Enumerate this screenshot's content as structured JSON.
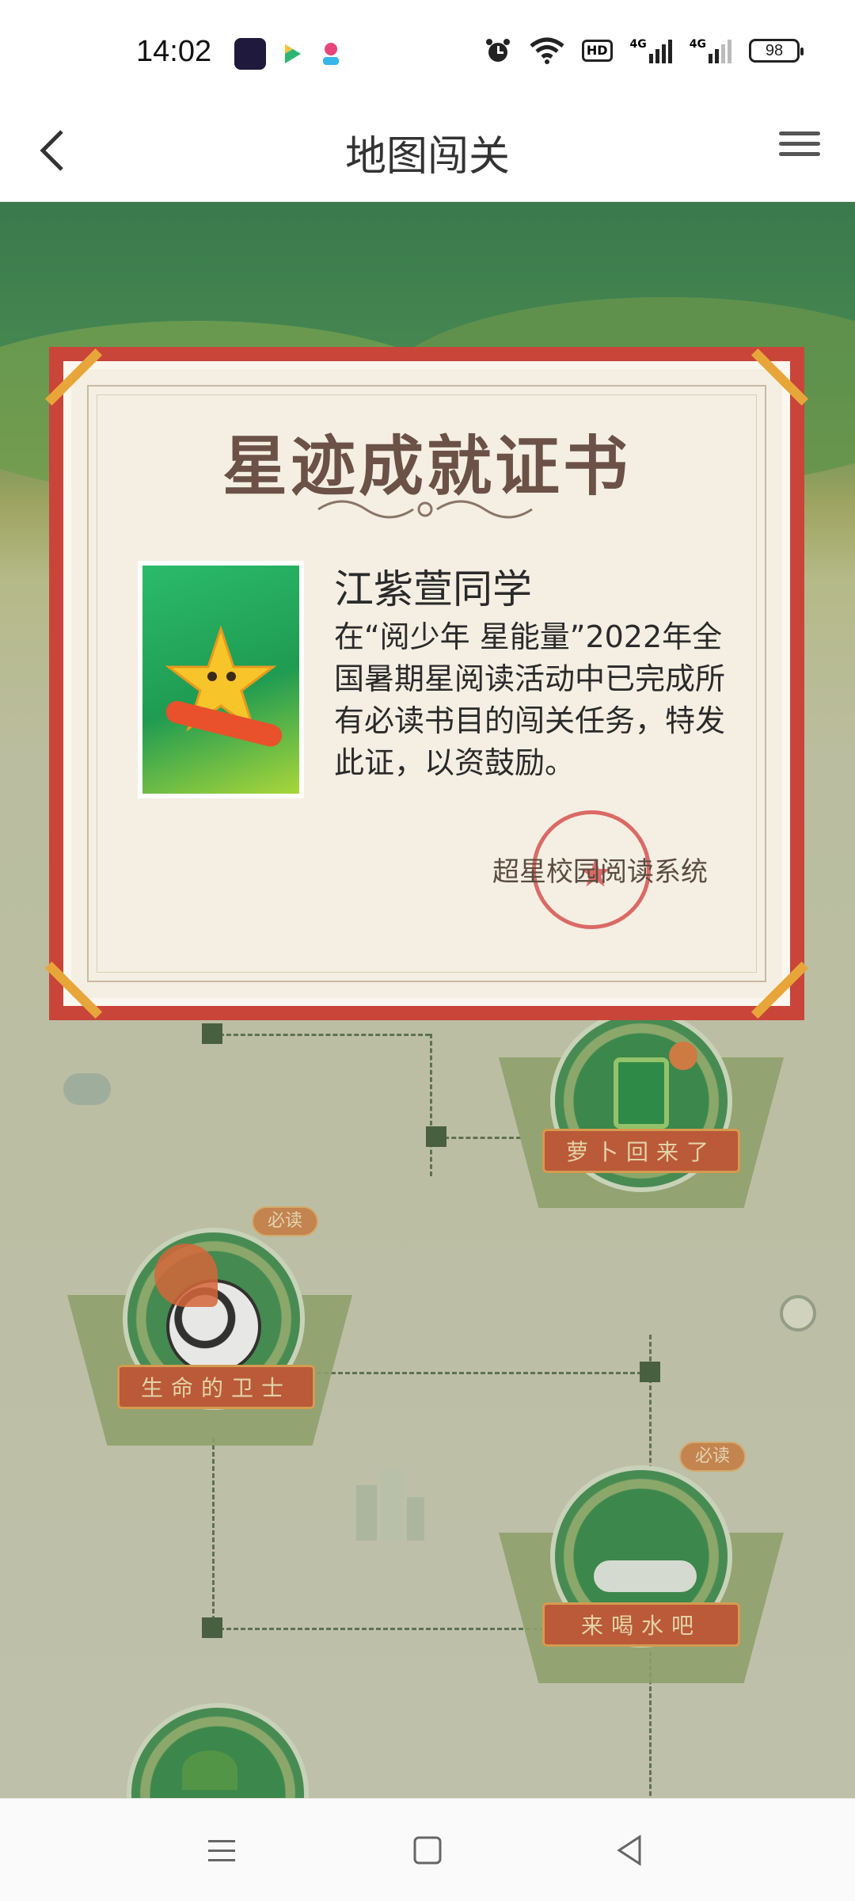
{
  "status_bar": {
    "time": "14:02",
    "battery": "98",
    "network": "4G",
    "hd_label": "HD"
  },
  "nav": {
    "title": "地图闯关"
  },
  "certificate": {
    "title": "星迹成就证书",
    "recipient": "江紫萱同学",
    "body": "在“阅少年 星能量”2022年全国暑期星阅读活动中已完成所有必读书目的闯关任务，特发此证，以资鼓励。",
    "issuer": "超星校园阅读系统",
    "colors": {
      "frame": "#c9453a",
      "paper": "#f5efe3",
      "title": "#6b5147"
    }
  },
  "levels": [
    {
      "name": "萝卜回来了",
      "badge": ""
    },
    {
      "name": "生命的卫士",
      "badge": "必读"
    },
    {
      "name": "来喝水吧",
      "badge": "必读"
    }
  ],
  "colors": {
    "accent": "#c9542d",
    "badge": "#d4874a"
  }
}
